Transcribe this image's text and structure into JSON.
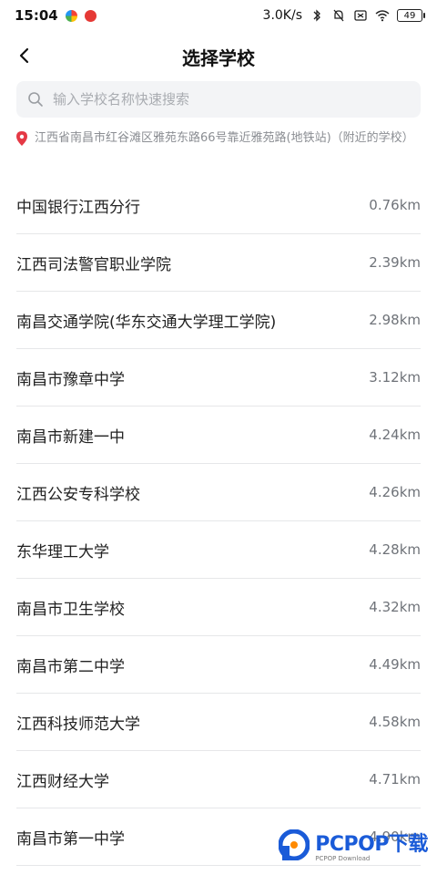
{
  "status_bar": {
    "time": "15:04",
    "net_speed": "3.0K/s",
    "battery": "49"
  },
  "header": {
    "title": "选择学校"
  },
  "search": {
    "placeholder": "输入学校名称快速搜索"
  },
  "location": {
    "text": "江西省南昌市红谷滩区雅苑东路66号靠近雅苑路(地铁站)（附近的学校）"
  },
  "schools": [
    {
      "name": "中国银行江西分行",
      "distance": "0.76km"
    },
    {
      "name": "江西司法警官职业学院",
      "distance": "2.39km"
    },
    {
      "name": "南昌交通学院(华东交通大学理工学院)",
      "distance": "2.98km"
    },
    {
      "name": "南昌市豫章中学",
      "distance": "3.12km"
    },
    {
      "name": "南昌市新建一中",
      "distance": "4.24km"
    },
    {
      "name": "江西公安专科学校",
      "distance": "4.26km"
    },
    {
      "name": "东华理工大学",
      "distance": "4.28km"
    },
    {
      "name": "南昌市卫生学校",
      "distance": "4.32km"
    },
    {
      "name": "南昌市第二中学",
      "distance": "4.49km"
    },
    {
      "name": "江西科技师范大学",
      "distance": "4.58km"
    },
    {
      "name": "江西财经大学",
      "distance": "4.71km"
    },
    {
      "name": "南昌市第一中学",
      "distance": "4.90km"
    }
  ],
  "watermark": {
    "brand": "PCPOP下载",
    "sub": "PCPOP Download"
  },
  "colors": {
    "location_pin": "#e53945",
    "divider": "#e6e7e9",
    "watermark": "#1a5bd8"
  }
}
